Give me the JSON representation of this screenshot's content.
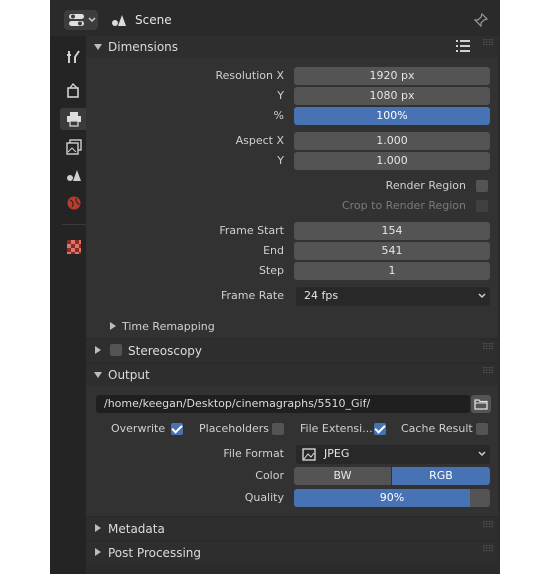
{
  "header": {
    "title": "Scene"
  },
  "dimensions": {
    "title": "Dimensions",
    "resolution_x_label": "Resolution X",
    "resolution_x": "1920 px",
    "resolution_y_label": "Y",
    "resolution_y": "1080 px",
    "percent_label": "%",
    "percent": "100%",
    "aspect_x_label": "Aspect X",
    "aspect_x": "1.000",
    "aspect_y_label": "Y",
    "aspect_y": "1.000",
    "render_region": "Render Region",
    "crop_region": "Crop to Render Region",
    "frame_start_label": "Frame Start",
    "frame_start": "154",
    "end_label": "End",
    "end": "541",
    "step_label": "Step",
    "step": "1",
    "frame_rate_label": "Frame Rate",
    "frame_rate": "24 fps",
    "time_remapping": "Time Remapping"
  },
  "stereoscopy": {
    "title": "Stereoscopy"
  },
  "output": {
    "title": "Output",
    "path": "/home/keegan/Desktop/cinemagraphs/5510_Gif/",
    "overwrite": "Overwrite",
    "placeholders": "Placeholders",
    "file_extensions": "File Extensi...",
    "cache_result": "Cache Result",
    "file_format_label": "File Format",
    "file_format": "JPEG",
    "color_label": "Color",
    "color_bw": "BW",
    "color_rgb": "RGB",
    "quality_label": "Quality",
    "quality": "90%",
    "quality_fraction": 0.9
  },
  "metadata": {
    "title": "Metadata"
  },
  "post_processing": {
    "title": "Post Processing"
  },
  "colors": {
    "accent": "#4772b3",
    "panel": "#323232",
    "field": "#545454"
  }
}
